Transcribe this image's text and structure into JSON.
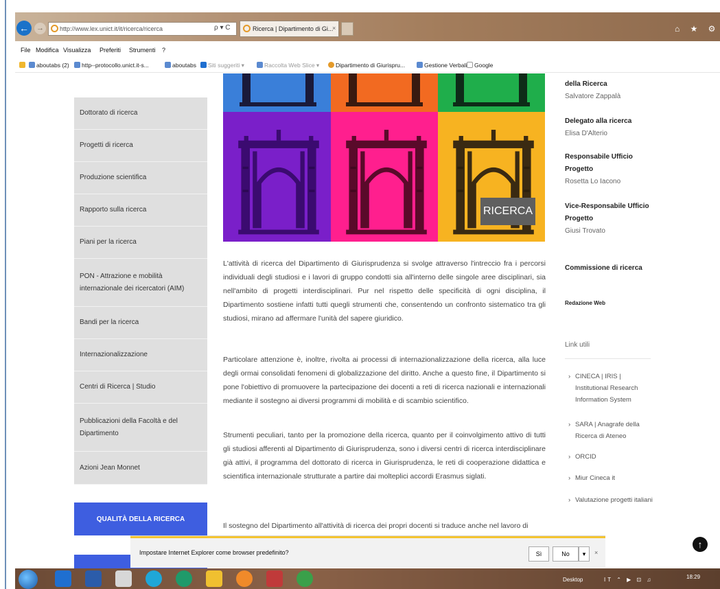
{
  "browser": {
    "address_url": "http://www.lex.unict.it/it/ricerca/ricerca",
    "address_tools": "ρ ▾ C",
    "tab_title": "Ricerca | Dipartimento di Gi...",
    "tab_close": "×",
    "win_controls": "⌂ ★ ⚙"
  },
  "menubar": [
    "File",
    "Modifica",
    "Visualizza",
    "Preferiti",
    "Strumenti",
    "?"
  ],
  "favorites": [
    "aboutabs (2)",
    "http--protocollo.unict.it-s...",
    "aboutabs",
    "Siti suggeriti ▾",
    "Raccolta Web Slice ▾",
    "Dipartimento di Giurispru...",
    "Gestione Verbali",
    "Google"
  ],
  "sidebar": {
    "items": [
      "Dottorato di ricerca",
      "Progetti di ricerca",
      "Produzione scientifica",
      "Rapporto sulla ricerca",
      "Piani per la ricerca",
      "PON - Attrazione e mobilità internazionale dei ricercatori (AIM)",
      "Bandi per la ricerca",
      "Internazionalizzazione",
      "Centri di Ricerca | Studio",
      "Pubblicazioni della Facoltà e del Dipartimento",
      "Azioni Jean Monnet"
    ],
    "quality_button": "QUALITÀ DELLA RICERCA"
  },
  "banner": {
    "badge": "RICERCA",
    "colors": {
      "top": [
        "#3a7fd9",
        "#f26a21",
        "#1fae4b"
      ],
      "bottom": [
        "#7a1fc9",
        "#ff1f8e",
        "#f7b321"
      ]
    }
  },
  "main": {
    "paragraphs": [
      "L'attività di ricerca del Dipartimento di Giurisprudenza si svolge attraverso l'intreccio fra i percorsi individuali degli studiosi e i lavori di gruppo condotti sia all'interno delle singole aree disciplinari, sia nell'ambito di progetti interdisciplinari. Pur nel rispetto delle specificità di ogni disciplina, il Dipartimento sostiene infatti tutti quegli strumenti che, consentendo un confronto sistematico tra gli studiosi, mirano ad affermare l'unità del sapere giuridico.",
      "Particolare attenzione è, inoltre, rivolta ai processi di internazionalizzazione della ricerca, alla luce degli ormai consolidati fenomeni di globalizzazione del diritto. Anche a questo fine, il Dipartimento si pone l'obiettivo di promuovere la partecipazione dei docenti a reti di ricerca nazionali e internazionali mediante il sostegno ai diversi programmi di mobilità e di scambio scientifico.",
      "Strumenti peculiari, tanto per la promozione della ricerca, quanto per il coinvolgimento attivo di tutti gli studiosi afferenti al Dipartimento di Giurisprudenza, sono i diversi centri di ricerca interdisciplinare già attivi, il programma del dottorato di ricerca in Giurisprudenza, le reti di cooperazione didattica e scientifica internazionale strutturate a partire dai molteplici accordi Erasmus siglati.",
      "Il sostegno del Dipartimento all'attività di ricerca dei propri docenti si traduce anche nel lavoro di"
    ]
  },
  "rightcol": {
    "roles": [
      {
        "title": "della Ricerca",
        "name": "Salvatore Zappalà"
      },
      {
        "title": "Delegato alla ricerca",
        "name": "Elisa D'Alterio"
      },
      {
        "title": "Responsabile Ufficio Progetto",
        "name": "Rosetta Lo Iacono"
      },
      {
        "title": "Vice-Responsabile Ufficio Progetto",
        "name": "Giusi Trovato"
      }
    ],
    "commissione": "Commissione di ricerca",
    "redazione": "Redazione Web",
    "links_title": "Link utili",
    "links": [
      "CINECA | IRIS | Institutional Research Information System",
      "SARA | Anagrafe della Ricerca di Ateneo",
      "ORCID",
      "Miur Cineca it",
      "Valutazione progetti italiani"
    ]
  },
  "ie_prompt": {
    "text": "Impostare Internet Explorer come browser predefinito?",
    "yes": "Sì",
    "no": "No",
    "arrow": "▾",
    "close": "×"
  },
  "scroll_top": "↑",
  "taskbar": {
    "desktop": "Desktop",
    "tray": "IT ⌃ ▶ ⊡ ♫",
    "time": "18:29"
  }
}
